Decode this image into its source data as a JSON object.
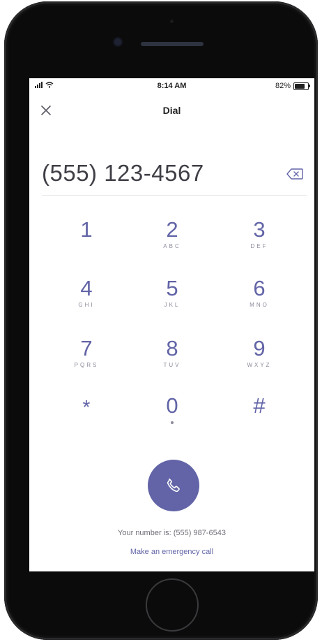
{
  "status_bar": {
    "time": "8:14 AM",
    "battery_text": "82%",
    "battery_level": 0.82
  },
  "header": {
    "title": "Dial",
    "close_icon": "close-icon"
  },
  "dialer": {
    "number": "(555) 123-4567",
    "backspace_icon": "backspace-icon"
  },
  "keypad": [
    {
      "digit": "1",
      "letters": ""
    },
    {
      "digit": "2",
      "letters": "ABC"
    },
    {
      "digit": "3",
      "letters": "DEF"
    },
    {
      "digit": "4",
      "letters": "GHI"
    },
    {
      "digit": "5",
      "letters": "JKL"
    },
    {
      "digit": "6",
      "letters": "MNO"
    },
    {
      "digit": "7",
      "letters": "PQRS"
    },
    {
      "digit": "8",
      "letters": "TUV"
    },
    {
      "digit": "9",
      "letters": "WXYZ"
    },
    {
      "digit": "*",
      "letters": ""
    },
    {
      "digit": "0",
      "letters": ""
    },
    {
      "digit": "#",
      "letters": ""
    }
  ],
  "footer": {
    "your_number": "Your number is: (555) 987-6543",
    "emergency_link": "Make an emergency call"
  },
  "colors": {
    "accent": "#6264a7",
    "phone_frame": "#0b0b0c",
    "text": "#3f3f46"
  }
}
